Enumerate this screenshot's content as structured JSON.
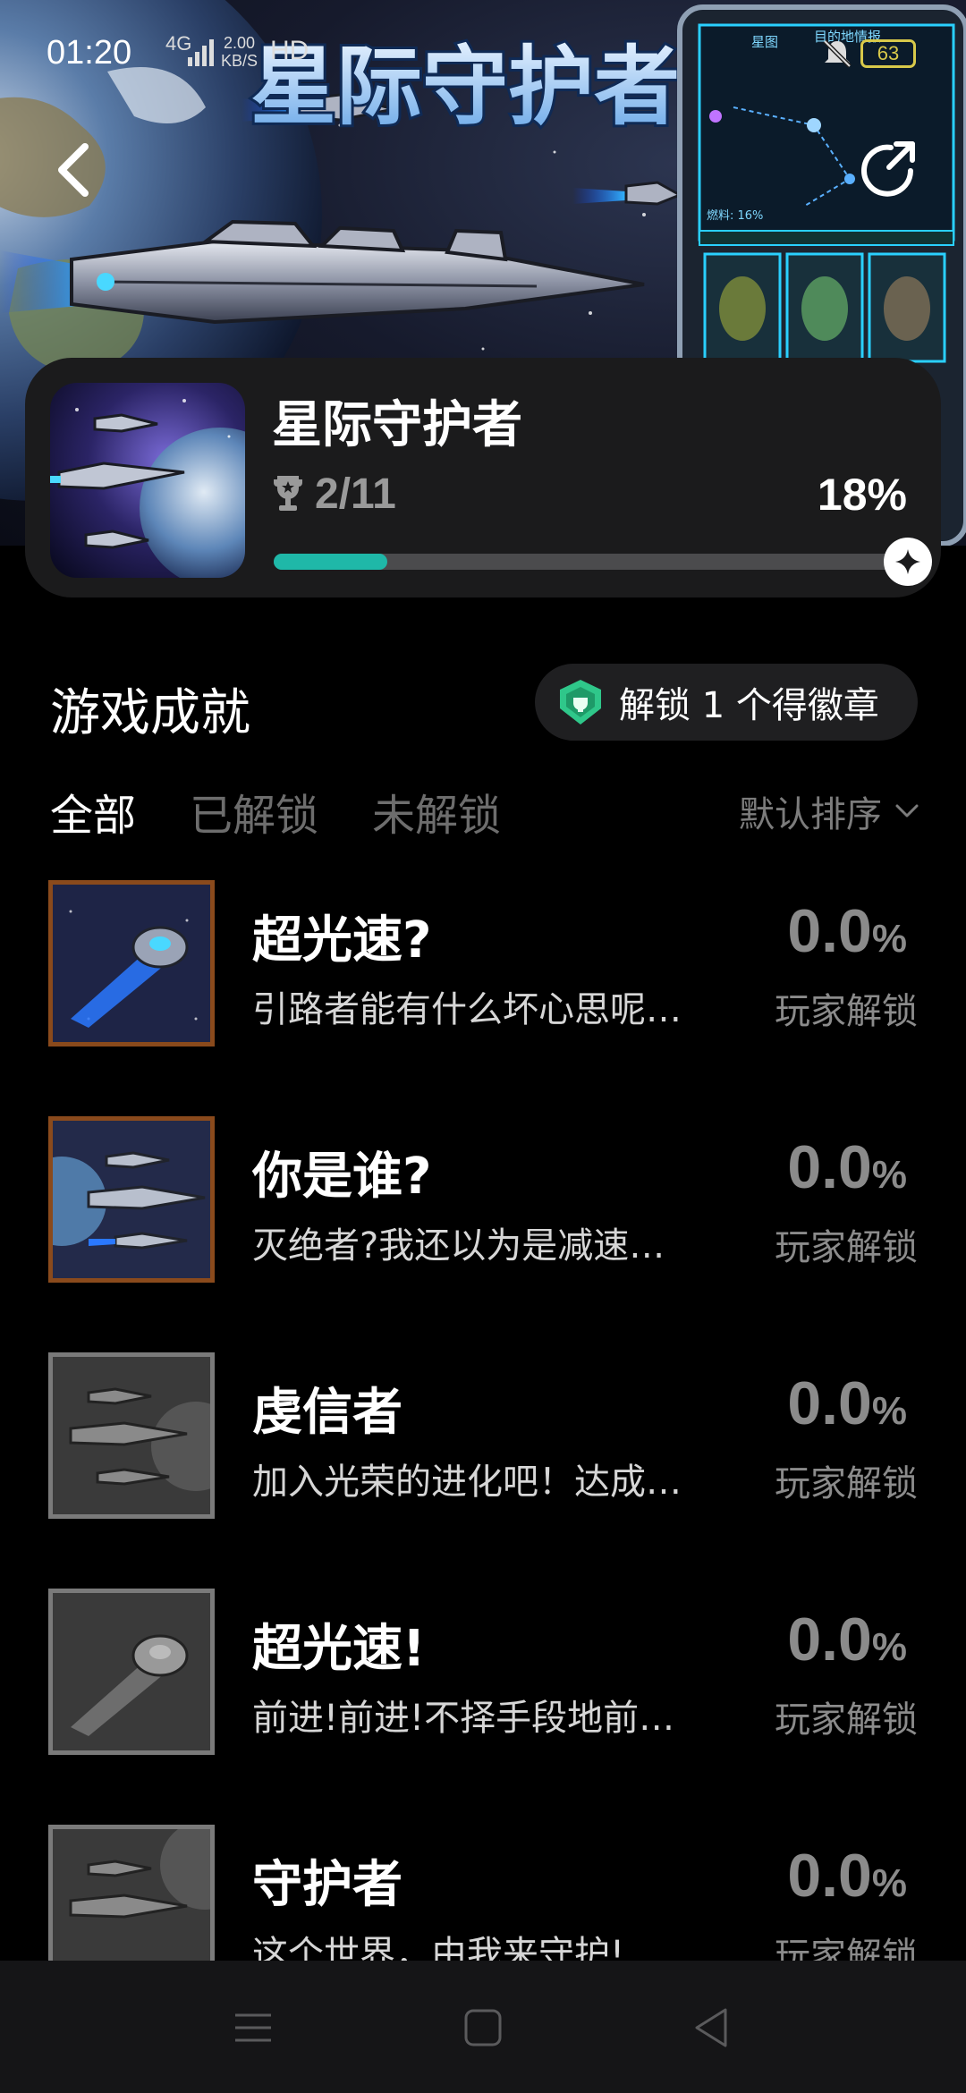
{
  "status_bar": {
    "time": "01:20",
    "network": "4G",
    "speed_value": "2.00",
    "speed_unit": "KB/S",
    "hd": "HD",
    "battery": "63"
  },
  "hero": {
    "banner_title": "星际守护者",
    "screen_tab_1": "星图",
    "screen_tab_2": "目的地情报",
    "screen_fuel": "燃料: 16%"
  },
  "game": {
    "title": "星际守护者",
    "trophy_count": "2/11",
    "percent_text": "18%",
    "progress": 0.18
  },
  "section": {
    "title": "游戏成就",
    "badge_text": "解锁 1 个得徽章"
  },
  "tabs": [
    {
      "label": "全部",
      "active": true
    },
    {
      "label": "已解锁",
      "active": false
    },
    {
      "label": "未解锁",
      "active": false
    }
  ],
  "sort": {
    "label": "默认排序"
  },
  "achievements": [
    {
      "name": "超光速?",
      "desc": "引路者能有什么坏心思呢…",
      "percent": "0.0",
      "percent_sign": "%",
      "players": "玩家解锁",
      "unlocked": true
    },
    {
      "name": "你是谁?",
      "desc": "灭绝者?我还以为是减速…",
      "percent": "0.0",
      "percent_sign": "%",
      "players": "玩家解锁",
      "unlocked": true
    },
    {
      "name": "虔信者",
      "desc": "加入光荣的进化吧！达成…",
      "percent": "0.0",
      "percent_sign": "%",
      "players": "玩家解锁",
      "unlocked": false
    },
    {
      "name": "超光速!",
      "desc": "前进!前进!不择手段地前…",
      "percent": "0.0",
      "percent_sign": "%",
      "players": "玩家解锁",
      "unlocked": false
    },
    {
      "name": "守护者",
      "desc": "这个世界，由我来守护!…",
      "percent": "0.0",
      "percent_sign": "%",
      "players": "玩家解锁",
      "unlocked": false
    }
  ],
  "colors": {
    "accent": "#1fb8a8",
    "card_bg": "#1b1b1c",
    "unlocked_border": "#8a4a1c",
    "locked_border": "#7a7a7a"
  },
  "icons": {
    "back": "chevron-left-icon",
    "share": "share-icon",
    "trophy": "trophy-icon",
    "badge": "badge-icon",
    "sort": "chevron-down-icon",
    "nav_menu": "menu-icon",
    "nav_home": "home-square-icon",
    "nav_back": "back-triangle-icon"
  }
}
